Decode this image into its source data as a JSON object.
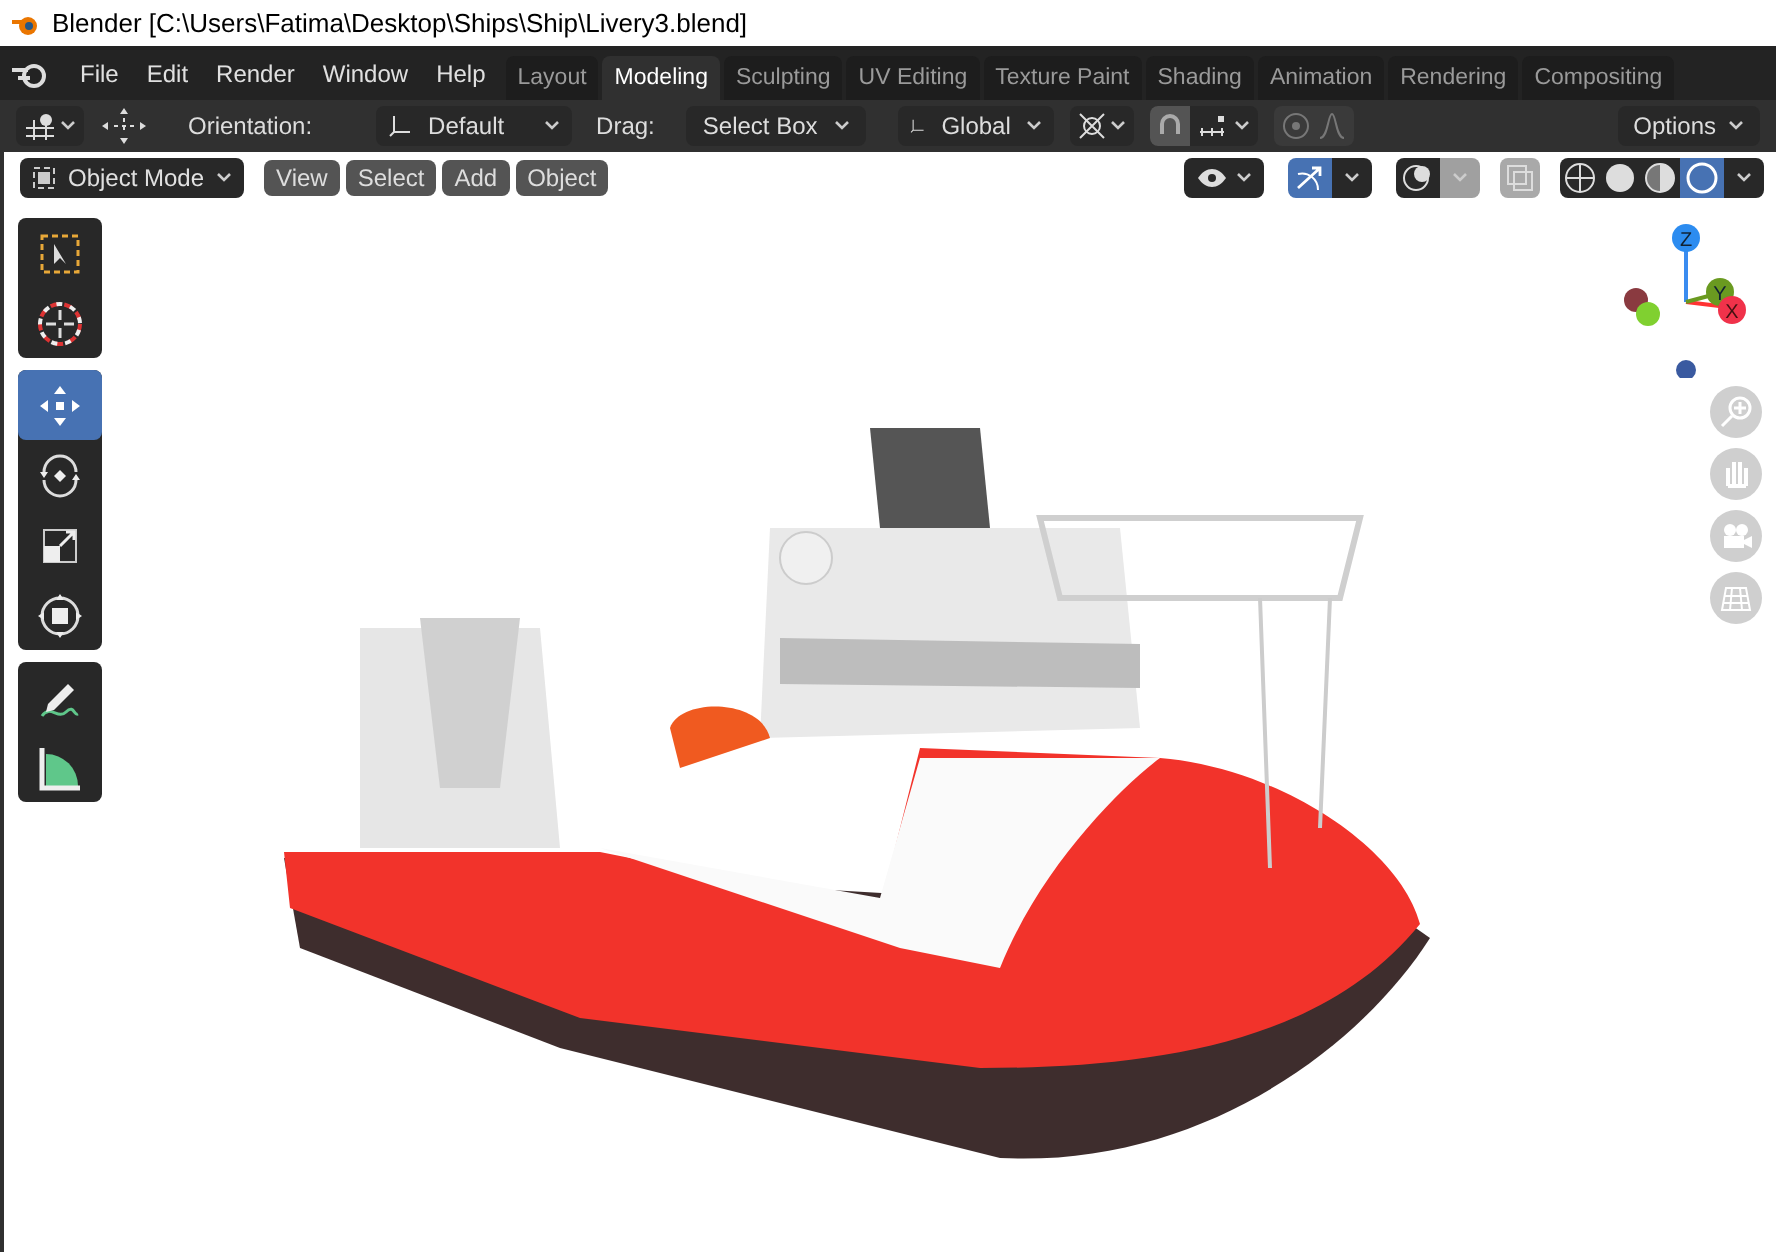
{
  "window": {
    "title": "Blender [C:\\Users\\Fatima\\Desktop\\Ships\\Ship\\Livery3.blend]"
  },
  "menu": [
    "File",
    "Edit",
    "Render",
    "Window",
    "Help"
  ],
  "workspace_tabs": [
    {
      "label": "Layout",
      "selected": false
    },
    {
      "label": "Modeling",
      "selected": true
    },
    {
      "label": "Sculpting",
      "selected": false
    },
    {
      "label": "UV Editing",
      "selected": false
    },
    {
      "label": "Texture Paint",
      "selected": false
    },
    {
      "label": "Shading",
      "selected": false
    },
    {
      "label": "Animation",
      "selected": false
    },
    {
      "label": "Rendering",
      "selected": false
    },
    {
      "label": "Compositing",
      "selected": false
    }
  ],
  "tool_header": {
    "orientation_label": "Orientation:",
    "orientation": "Default",
    "drag_label": "Drag:",
    "drag": "Select Box",
    "transform": "Global",
    "options": "Options"
  },
  "viewport_header": {
    "mode": "Object Mode",
    "menus": [
      "View",
      "Select",
      "Add",
      "Object"
    ]
  },
  "toolbar": [
    [
      {
        "kind": "select",
        "selected": false
      },
      {
        "kind": "cursor",
        "selected": false
      }
    ],
    [
      {
        "kind": "move",
        "selected": true
      },
      {
        "kind": "rotate",
        "selected": false
      },
      {
        "kind": "scale",
        "selected": false
      },
      {
        "kind": "transform",
        "selected": false
      }
    ],
    [
      {
        "kind": "annotate",
        "selected": false
      },
      {
        "kind": "measure",
        "selected": false
      }
    ]
  ],
  "gizmo": {
    "z": "Z",
    "y": "Y",
    "x": "X"
  }
}
